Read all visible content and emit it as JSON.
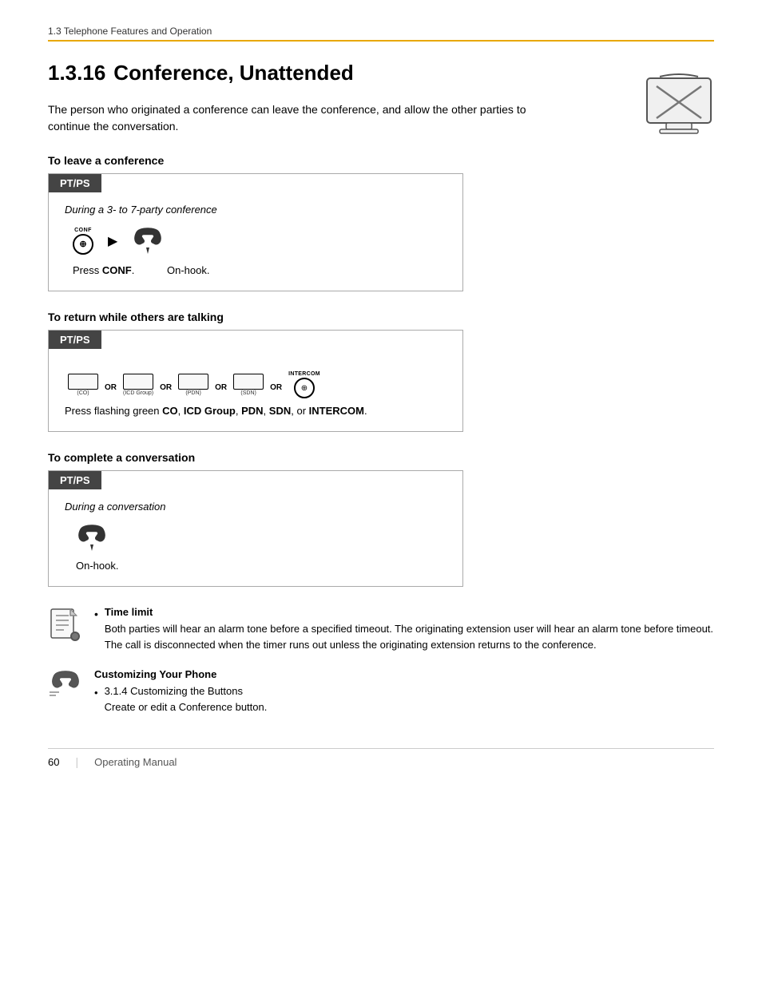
{
  "breadcrumb": "1.3 Telephone Features and Operation",
  "page_title": {
    "section": "1.3.16",
    "title": "Conference, Unattended"
  },
  "intro": "The person who originated a conference can leave the conference, and allow the other parties to continue the conversation.",
  "section_leave": {
    "header": "To leave a conference",
    "label": "PT/PS",
    "italic": "During a 3- to 7-party conference",
    "step1_label": "Press CONF.",
    "step1_bold": "CONF",
    "step2_label": "On-hook."
  },
  "section_return": {
    "header": "To return while others are talking",
    "label": "PT/PS",
    "press_text": "Press flashing green ",
    "press_keys": "CO, ICD Group, PDN, SDN, or INTERCOM.",
    "keys": [
      {
        "label": "",
        "sub": "(CO)"
      },
      {
        "label": "",
        "sub": "(ICD Group)"
      },
      {
        "label": "",
        "sub": "(PDN)"
      },
      {
        "label": "",
        "sub": "(SDN)"
      }
    ],
    "or_label": "OR"
  },
  "section_complete": {
    "header": "To complete a conversation",
    "label": "PT/PS",
    "italic": "During a conversation",
    "onhook_label": "On-hook."
  },
  "notes": [
    {
      "type": "note",
      "title": "Time limit",
      "text": "Both parties will hear an alarm tone before a specified timeout. The originating extension user will hear an alarm tone before timeout. The call is disconnected when the timer runs out unless the originating extension returns to the conference."
    },
    {
      "type": "customize",
      "title": "Customizing Your Phone",
      "items": [
        "3.1.4 Customizing the Buttons",
        "Create or edit a Conference button."
      ]
    }
  ],
  "footer": {
    "page": "60",
    "manual": "Operating Manual"
  }
}
